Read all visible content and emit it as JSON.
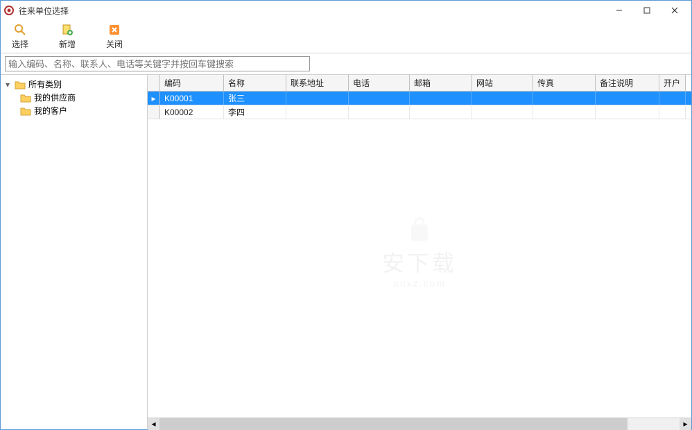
{
  "window": {
    "title": "往来单位选择"
  },
  "toolbar": {
    "select": "选择",
    "add": "新增",
    "close": "关闭"
  },
  "search": {
    "placeholder": "输入编码、名称、联系人、电话等关键字并按回车键搜索"
  },
  "tree": {
    "root": "所有类别",
    "items": [
      "我的供应商",
      "我的客户"
    ]
  },
  "grid": {
    "columns": [
      "编码",
      "名称",
      "联系地址",
      "电话",
      "邮箱",
      "网站",
      "传真",
      "备注说明",
      "开户"
    ],
    "rows": [
      {
        "code": "K00001",
        "name": "张三",
        "addr": "",
        "phone": "",
        "mail": "",
        "web": "",
        "fax": "",
        "note": "",
        "bank": "",
        "selected": true
      },
      {
        "code": "K00002",
        "name": "李四",
        "addr": "",
        "phone": "",
        "mail": "",
        "web": "",
        "fax": "",
        "note": "",
        "bank": "",
        "selected": false
      }
    ]
  },
  "watermark": {
    "text": "安下载",
    "sub": "anxz.com"
  }
}
